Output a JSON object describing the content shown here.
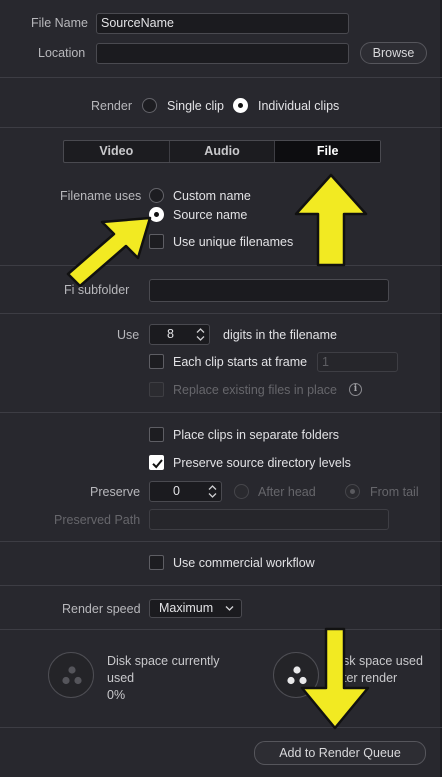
{
  "file_name": {
    "label": "File Name",
    "value": "SourceName"
  },
  "location": {
    "label": "Location",
    "value": "",
    "browse_label": "Browse"
  },
  "render": {
    "label": "Render",
    "options": [
      "Single clip",
      "Individual clips"
    ],
    "selected": "Individual clips"
  },
  "tabs": {
    "items": [
      "Video",
      "Audio",
      "File"
    ],
    "active": "File"
  },
  "filename_uses": {
    "label": "Filename uses",
    "options": [
      "Custom name",
      "Source name"
    ],
    "selected": "Source name",
    "unique_label": "Use unique filenames",
    "unique_checked": false
  },
  "subfolder": {
    "label": "File subfolder",
    "visible_label": "Fi  subfolder",
    "value": ""
  },
  "digits": {
    "use_label": "Use",
    "value": "8",
    "suffix": "digits in the filename",
    "each_clip_label": "Each clip starts at frame",
    "each_clip_checked": false,
    "start_frame": "1",
    "replace_label": "Replace existing files in place",
    "replace_enabled": false,
    "info_icon": "i"
  },
  "folders": {
    "separate_label": "Place clips in separate folders",
    "separate_checked": false,
    "preserve_levels_label": "Preserve source directory levels",
    "preserve_levels_checked": true,
    "preserve_label": "Preserve",
    "preserve_value": "0",
    "after_head_label": "After head",
    "from_tail_label": "From tail",
    "from_tail_selected": true,
    "preserved_path_label": "Preserved Path",
    "preserved_path_value": ""
  },
  "commercial": {
    "label": "Use commercial workflow",
    "checked": false
  },
  "render_speed": {
    "label": "Render speed",
    "value": "Maximum"
  },
  "disk": {
    "current_line1": "Disk space currently",
    "current_line2": "used",
    "current_value": "0%",
    "after_line1": "sk space used",
    "after_line2": "ter render"
  },
  "add_queue_label": "Add to Render Queue",
  "colors": {
    "panel": "#28282e",
    "arrow": "#f2ea22",
    "divider": "#3d3d44",
    "field": "#1b1b1f"
  },
  "annotations": {
    "arrow_1_icon": "yellow-arrow-pointing-to-source-name",
    "arrow_2_icon": "yellow-arrow-pointing-up-to-file-tab",
    "arrow_3_icon": "yellow-arrow-pointing-down-to-add-to-render-queue"
  }
}
